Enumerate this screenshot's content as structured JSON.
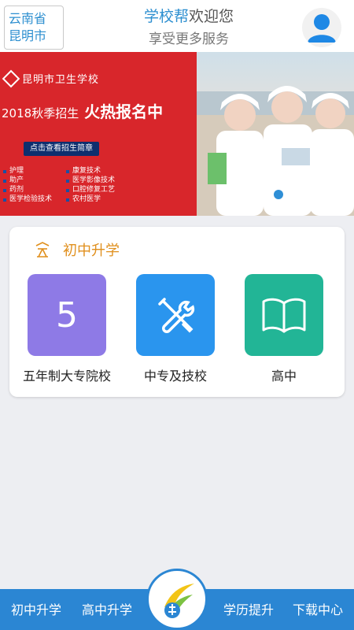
{
  "header": {
    "location_line1": "云南省",
    "location_line2": "昆明市",
    "brand": "学校帮",
    "welcome": "欢迎您",
    "subtitle": "享受更多服务",
    "avatar_icon": "user-icon"
  },
  "banner": {
    "school_name": "昆明市卫生学校",
    "year": "2018",
    "season": "秋季招生",
    "headline": "火热报名中",
    "brochure_button": "点击查看招生简章",
    "majors": [
      "护理",
      "康复技术",
      "助产",
      "医学影像技术",
      "药剂",
      "口腔修复工艺",
      "医学检验技术",
      "农村医学"
    ],
    "slide_count": 4,
    "active_slide": 2,
    "accent_red": "#d8262b",
    "accent_navy": "#0e2f6e"
  },
  "section": {
    "icon": "education-icon",
    "title": "初中升学",
    "title_color": "#e08f1c",
    "tiles": [
      {
        "label": "五年制大专院校",
        "glyph": "5",
        "icon": "five-icon",
        "color": "#8e7ae6"
      },
      {
        "label": "中专及技校",
        "icon": "tools-icon",
        "color": "#2a95ee"
      },
      {
        "label": "高中",
        "icon": "book-icon",
        "color": "#22b596"
      }
    ]
  },
  "bottom_nav": {
    "items": [
      "初中升学",
      "高中升学",
      "学历提升",
      "下载中心"
    ],
    "center_icon": "app-logo-icon",
    "color": "#2b86d3"
  }
}
